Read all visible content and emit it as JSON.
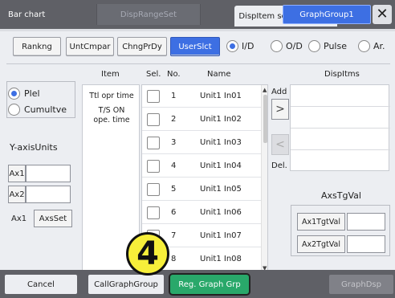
{
  "tabs": {
    "chart": "Bar chart",
    "range": "DispRangeSet",
    "item": "DispItem set",
    "group": "GraphGroup1",
    "close": "✕"
  },
  "buttons": {
    "ranking": "Rankng",
    "unt": "UntCmpar",
    "chng": "ChngPrDy",
    "user": "UserSlct"
  },
  "radios": {
    "id": "I/D",
    "od": "O/D",
    "pulse": "Pulse",
    "ar": "Ar."
  },
  "headers": {
    "item": "Item",
    "sel": "Sel.",
    "no": "No.",
    "name": "Name",
    "disp": "DispItms"
  },
  "left": {
    "plel": "Plel",
    "cumul": "Cumultve",
    "yaxis": "Y-axisUnits",
    "ax1": "Ax1",
    "ax2": "Ax2",
    "ax_static": "Ax1",
    "axsset": "AxsSet"
  },
  "items": {
    "item1": "Ttl opr time",
    "item2a": "T/S ON",
    "item2b": "ope. time"
  },
  "rows": [
    {
      "no": "1",
      "name": "Unit1 In01"
    },
    {
      "no": "2",
      "name": "Unit1 In02"
    },
    {
      "no": "3",
      "name": "Unit1 In03"
    },
    {
      "no": "4",
      "name": "Unit1 In04"
    },
    {
      "no": "5",
      "name": "Unit1 In05"
    },
    {
      "no": "6",
      "name": "Unit1 In06"
    },
    {
      "no": "7",
      "name": "Unit1 In07"
    },
    {
      "no": "8",
      "name": "Unit1 In08"
    }
  ],
  "mid": {
    "add": "Add",
    "del": "Del.",
    "add_arrow": ">",
    "del_arrow": "<"
  },
  "axstg": {
    "title": "AxsTgVal",
    "ax1btn": "Ax1TgtVal",
    "ax2btn": "Ax2TgtVal"
  },
  "bottom": {
    "cancel": "Cancel",
    "call": "CallGraphGroup",
    "reg": "Reg. Graph Grp",
    "disp": "GraphDsp"
  },
  "callout": "4"
}
